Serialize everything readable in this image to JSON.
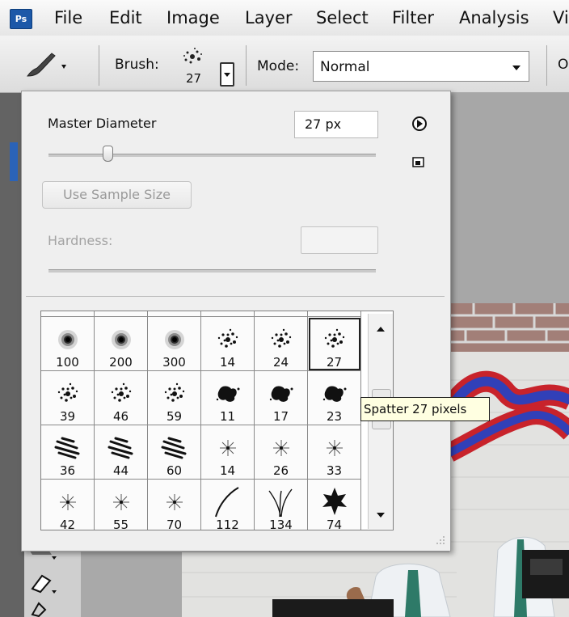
{
  "app": {
    "logo_text": "Ps"
  },
  "menu": [
    "File",
    "Edit",
    "Image",
    "Layer",
    "Select",
    "Filter",
    "Analysis",
    "Vi"
  ],
  "options_bar": {
    "brush_label": "Brush:",
    "brush_size": "27",
    "mode_label": "Mode:",
    "mode_value": "Normal",
    "trailing_label": "O"
  },
  "brush_panel": {
    "master_diameter_label": "Master Diameter",
    "master_diameter_value": "27 px",
    "use_sample_size_label": "Use Sample Size",
    "hardness_label": "Hardness:",
    "diameter_slider_level": 0.18
  },
  "brush_grid": {
    "top_partial_row": [
      "",
      "",
      "",
      "",
      "",
      ""
    ],
    "rows": [
      [
        {
          "size": "100",
          "kind": "soft"
        },
        {
          "size": "200",
          "kind": "soft"
        },
        {
          "size": "300",
          "kind": "soft"
        },
        {
          "size": "14",
          "kind": "spatter"
        },
        {
          "size": "24",
          "kind": "spatter"
        },
        {
          "size": "27",
          "kind": "spatter",
          "selected": true
        }
      ],
      [
        {
          "size": "39",
          "kind": "spatter"
        },
        {
          "size": "46",
          "kind": "spatter"
        },
        {
          "size": "59",
          "kind": "spatter"
        },
        {
          "size": "11",
          "kind": "blot"
        },
        {
          "size": "17",
          "kind": "blot"
        },
        {
          "size": "23",
          "kind": "blot"
        }
      ],
      [
        {
          "size": "36",
          "kind": "chalk"
        },
        {
          "size": "44",
          "kind": "chalk"
        },
        {
          "size": "60",
          "kind": "chalk"
        },
        {
          "size": "14",
          "kind": "star"
        },
        {
          "size": "26",
          "kind": "star"
        },
        {
          "size": "33",
          "kind": "star"
        }
      ],
      [
        {
          "size": "42",
          "kind": "star"
        },
        {
          "size": "55",
          "kind": "star"
        },
        {
          "size": "70",
          "kind": "star"
        },
        {
          "size": "112",
          "kind": "stroke"
        },
        {
          "size": "134",
          "kind": "grass"
        },
        {
          "size": "74",
          "kind": "leaf"
        }
      ]
    ]
  },
  "tooltip": {
    "text": "Spatter 27 pixels"
  },
  "colors": {
    "selection_outline": "#222222",
    "tooltip_bg": "#ffffe1",
    "stroke_red": "#c8232b",
    "stroke_blue": "#3140b8"
  }
}
